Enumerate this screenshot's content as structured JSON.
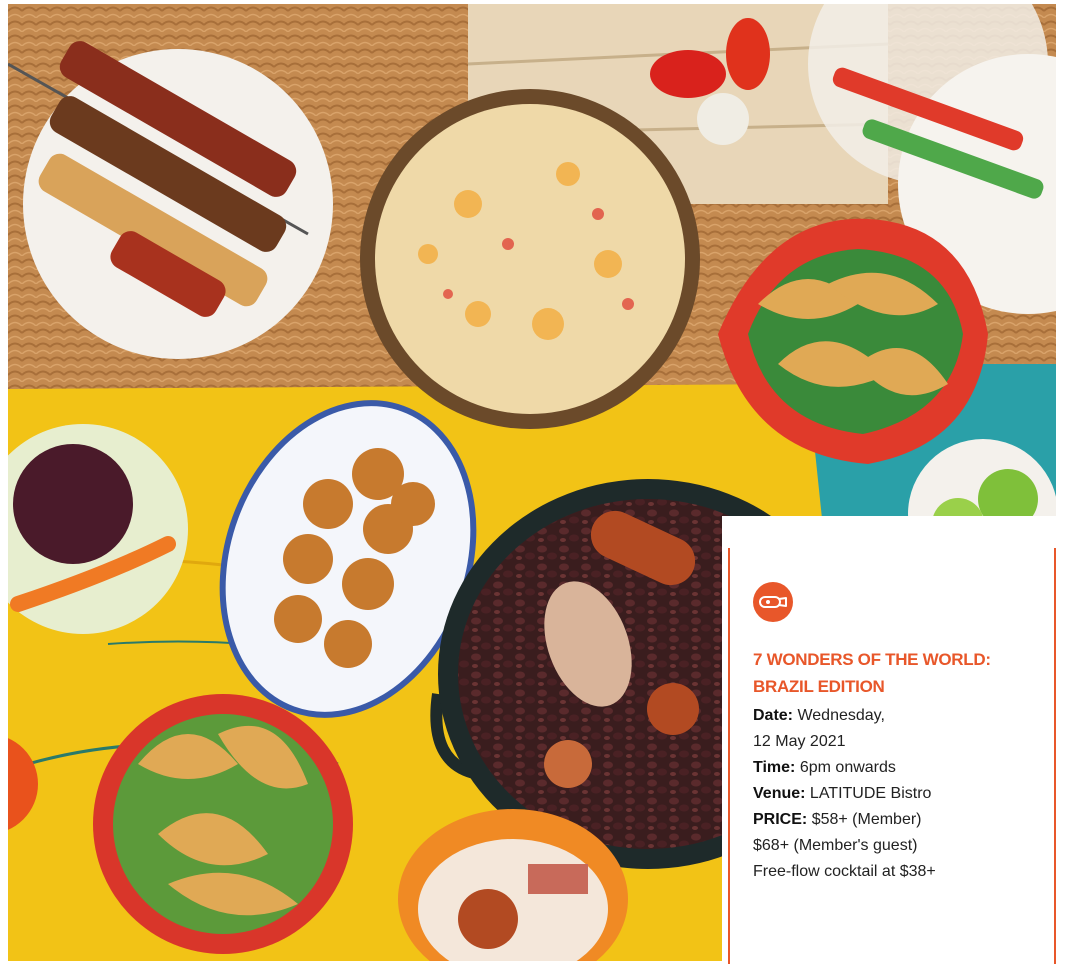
{
  "photo": {
    "subject": "food-spread-photo",
    "colors": {
      "wood_yellow": "#f2c316",
      "wicker": "#c98f54",
      "cream_stew": "#efd9a8",
      "beans": "#3a1d1e",
      "sausage": "#b24a22",
      "plate_red": "#d9362a",
      "plate_green": "#5c9a3a",
      "pastry": "#e0a955",
      "croquette": "#c77a2e",
      "orange_spoon": "#f07a24"
    }
  },
  "event": {
    "badge_icon": "whistle-icon",
    "title": "7 WONDERS OF THE WORLD: BRAZIL EDITION",
    "date_label": "Date:",
    "date_value_line1": "Wednesday,",
    "date_value_line2": "12 May 2021",
    "time_label": "Time:",
    "time_value": "6pm onwards",
    "venue_label": "Venue:",
    "venue_value": "LATITUDE Bistro",
    "price_label": "PRICE:",
    "price_member": "$58+ (Member)",
    "price_guest": "$68+ (Member's guest)",
    "cocktail": "Free-flow cocktail at $38+",
    "accent": "#e8572a"
  }
}
